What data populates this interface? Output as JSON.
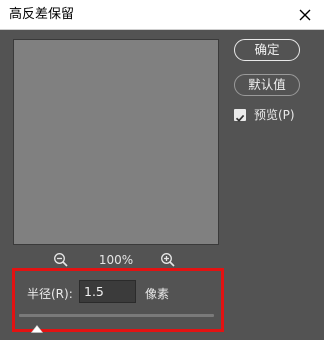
{
  "window": {
    "title": "高反差保留"
  },
  "preview": {
    "zoom_level": "100%"
  },
  "buttons": {
    "ok_label": "确定",
    "default_label": "默认值"
  },
  "preview_option": {
    "label": "预览(P)",
    "checked": true
  },
  "radius": {
    "label": "半径(R):",
    "value": "1.5",
    "unit": "像素"
  },
  "colors": {
    "background": "#535353",
    "preview_fill": "#808080",
    "highlight_border": "#e31212"
  },
  "icons": {
    "close": "close-icon",
    "zoom_out": "zoom-out-icon",
    "zoom_in": "zoom-in-icon",
    "check": "check-icon",
    "slider_thumb": "slider-thumb-icon"
  }
}
